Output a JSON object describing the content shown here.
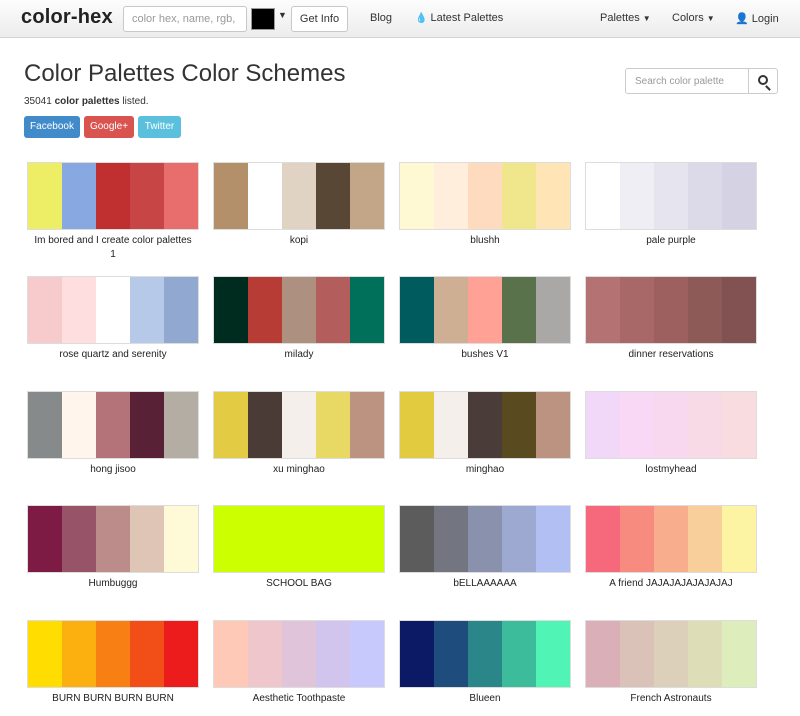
{
  "navbar": {
    "brand": "color-hex",
    "search_placeholder": "color hex, name, rgb, hsl",
    "swatch_color": "#000000",
    "get_info_label": "Get Info",
    "blog_label": "Blog",
    "latest_label": "Latest Palettes",
    "palettes_label": "Palettes",
    "colors_label": "Colors",
    "login_label": "Login"
  },
  "header": {
    "title": "Color Palettes Color Schemes",
    "count": "35041",
    "count_bold": "color palettes",
    "count_suffix": "listed.",
    "search_placeholder": "Search color palette",
    "share": {
      "facebook": "Facebook",
      "google": "Google+",
      "twitter": "Twitter"
    }
  },
  "palettes": [
    {
      "name": "Im bored and I create color palettes 1",
      "colors": [
        "#eeee66",
        "#87a8e0",
        "#c03030",
        "#c84545",
        "#e86e6e"
      ]
    },
    {
      "name": "kopi",
      "colors": [
        "#b39069",
        "#ffffff",
        "#e1d3c3",
        "#574734",
        "#c3a687"
      ]
    },
    {
      "name": "blushh",
      "colors": [
        "#fef9d2",
        "#ffeedc",
        "#fedbbe",
        "#f0e68c",
        "#ffe4b5"
      ]
    },
    {
      "name": "pale purple",
      "colors": [
        "#ffffff",
        "#efeef4",
        "#e6e4ee",
        "#dcdae8",
        "#d5d2e4"
      ]
    },
    {
      "name": "rose quartz and serenity",
      "colors": [
        "#f7cacb",
        "#fededf",
        "#ffffff",
        "#b7c9e8",
        "#91a8d0"
      ]
    },
    {
      "name": "milady",
      "colors": [
        "#002c20",
        "#b83c36",
        "#ad9080",
        "#b45d5d",
        "#00705a"
      ]
    },
    {
      "name": "bushes V1",
      "colors": [
        "#005b5e",
        "#cfaf93",
        "#ffa195",
        "#5a724c",
        "#aaa8a6"
      ]
    },
    {
      "name": "dinner reservations",
      "colors": [
        "#b47272",
        "#a96868",
        "#9d605f",
        "#8e5a58",
        "#825252"
      ]
    },
    {
      "name": "hong jisoo",
      "colors": [
        "#868a8a",
        "#fff5ec",
        "#b47279",
        "#582136",
        "#b3ada4"
      ]
    },
    {
      "name": "xu minghao",
      "colors": [
        "#e3cb44",
        "#4a3b36",
        "#f4efea",
        "#e8d864",
        "#bc9280"
      ]
    },
    {
      "name": "minghao",
      "colors": [
        "#e3cb40",
        "#f4efea",
        "#4a3c38",
        "#5a4a20",
        "#bc9280"
      ]
    },
    {
      "name": "lostmyhead",
      "colors": [
        "#f2d8f8",
        "#f8d8f4",
        "#f8d8ee",
        "#f8dae6",
        "#f8dce0"
      ]
    },
    {
      "name": "Humbuggg",
      "colors": [
        "#7d1b45",
        "#975368",
        "#bb8c8a",
        "#dfc5b6",
        "#fef9d6"
      ]
    },
    {
      "name": "SCHOOL BAG",
      "colors": [
        "#ccff00",
        "#ccff00",
        "#ccff00",
        "#ccff00",
        "#ccff00"
      ]
    },
    {
      "name": "bELLAAAAAA",
      "colors": [
        "#5c5c5c",
        "#737680",
        "#8a91ac",
        "#9ea9d2",
        "#b1bff2"
      ]
    },
    {
      "name": "A friend JAJAJAJAJAJAJAJ",
      "colors": [
        "#f6687b",
        "#f88b7f",
        "#f8ad8c",
        "#f8cf9a",
        "#fcf4a3"
      ]
    },
    {
      "name": "BURN BURN BURN BURN",
      "colors": [
        "#ffdd00",
        "#fbb00f",
        "#f77f14",
        "#f24e17",
        "#ed1c1c"
      ]
    },
    {
      "name": "Aesthetic Toothpaste",
      "colors": [
        "#fec9b6",
        "#eec6cc",
        "#dfc4da",
        "#d1c4ed",
        "#c7c8fb"
      ]
    },
    {
      "name": "Blueen",
      "colors": [
        "#0c1a66",
        "#1e4c7c",
        "#2a8688",
        "#3cbc9b",
        "#50f4b4"
      ]
    },
    {
      "name": "French Astronauts",
      "colors": [
        "#dbafb8",
        "#dbc2b9",
        "#ddd0bb",
        "#ddddb8",
        "#ddeebc"
      ]
    }
  ]
}
